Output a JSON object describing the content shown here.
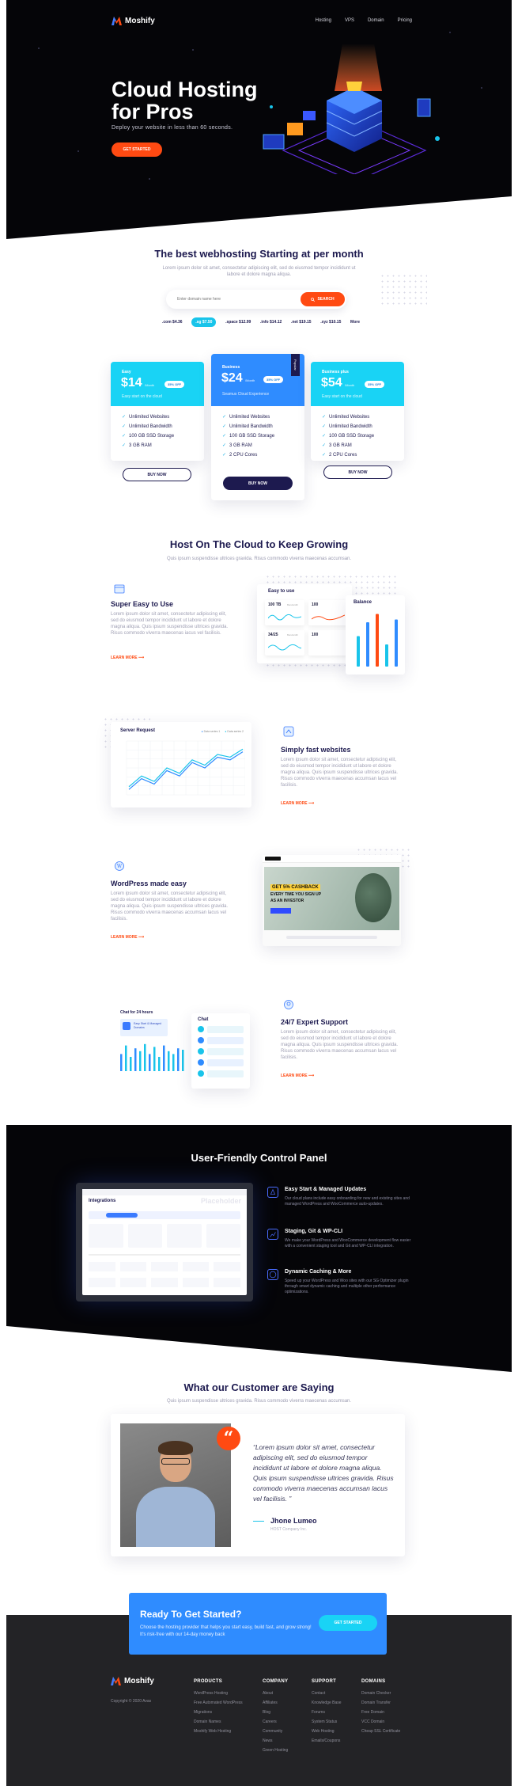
{
  "nav": {
    "brand": "Moshify",
    "links": [
      "Hosting",
      "VPS",
      "Domain",
      "Pricing"
    ]
  },
  "hero": {
    "title": "Cloud Hosting for Pros",
    "subtitle": "Deploy your website in less than 60 seconds.",
    "cta": "GET STARTED"
  },
  "pricing_intro": {
    "title": "The best webhosting Starting at per month",
    "subtitle": "Lorem ipsum dolor sit amet, consectetur adipiscing elit, sed do eiusmod tempor incididunt ut labore et dolore magna aliqua.",
    "search_placeholder": "Enter domain name here",
    "search_button": "SEARCH",
    "domains": [
      ".com $4.36",
      ".sg $7.50",
      ".space $12.99",
      ".info $14.12",
      ".net $19.15",
      ".xyz $10.15",
      "More"
    ]
  },
  "plans": [
    {
      "name": "Easy",
      "price": "$14",
      "per": "/Month",
      "off": "35% OFF",
      "tag": "Easy start on the cloud",
      "features": [
        "Unlimited Websites",
        "Unlimited Bandwidth",
        "100 GB SSD Storage",
        "3 GB RAM"
      ],
      "button": "BUY NOW"
    },
    {
      "name": "Business",
      "price": "$24",
      "per": "/Month",
      "off": "35% OFF",
      "tag": "Seamus Cloud Experience",
      "ribbon": "Popular",
      "features": [
        "Unlimited Websites",
        "Unlimited Bandwidth",
        "100 GB SSD Storage",
        "3 GB RAM",
        "2 CPU Cores"
      ],
      "button": "BUY NOW"
    },
    {
      "name": "Business plus",
      "price": "$54",
      "per": "/Month",
      "off": "35% OFF",
      "tag": "Easy start on the cloud",
      "features": [
        "Unlimited Websites",
        "Unlimited Bandwidth",
        "100 GB SSD Storage",
        "3 GB RAM",
        "2 CPU Cores"
      ],
      "button": "BUY NOW"
    }
  ],
  "grow": {
    "title": "Host On The Cloud to Keep Growing",
    "subtitle": "Quis ipsum suspendisse ultrices gravida. Risus commodo viverra maecenas accumsan."
  },
  "features": [
    {
      "title": "Super Easy to Use",
      "text": "Lorem ipsum dolor sit amet, consectetur adipiscing elit, sed do eiusmod tempor incididunt ut labore et dolore magna aliqua. Quis ipsum suspendisse ultrices gravida. Risus commodo viverra maecenas iacus vel facilisis.",
      "link": "LEARN MORE"
    },
    {
      "title": "Simply fast websites",
      "text": "Lorem ipsum dolor sit amet, consectetur adipiscing elit, sed do eiusmod tempor incididunt ut labore et dolore magna aliqua. Quis ipsum suspendisse ultrices gravida. Risus commodo viverra maecenas accumsan lacus vel facilisis.",
      "link": "LEARN MORE"
    },
    {
      "title": "WordPress made easy",
      "text": "Lorem ipsum dolor sit amet, consectetur adipiscing elit, sed do eiusmod tempor incididunt ut labore et dolore magna aliqua. Quis ipsum suspendisse ultrices gravida. Risus commodo viverra maecenas accumsan lacus vel facilisis.",
      "link": "LEARN MORE"
    },
    {
      "title": "24/7 Expert Support",
      "text": "Lorem ipsum dolor sit amet, consectetur adipiscing elit, sed do eiusmod tempor incididunt ut labore et dolore magna aliqua. Quis ipsum suspendisse ultrices gravida. Risus commodo viverra maecenas accumsan lacus vel facilisis.",
      "link": "LEARN MORE"
    }
  ],
  "widgets": {
    "easy_title": "Easy to use",
    "easy_stats": [
      "100 TB",
      "34/25",
      "100",
      "100"
    ],
    "easy_stat_labels": [
      "Bandwidth",
      "Bandwidth"
    ],
    "balance_title": "Balance",
    "balance_bars": [
      0.55,
      0.8,
      0.95,
      0.4,
      0.85
    ],
    "server_title": "Server Request",
    "server_legend": [
      "Data series 1",
      "Data series 2"
    ],
    "server_series1": [
      2,
      6,
      4,
      9,
      7,
      12,
      10,
      14,
      13,
      16
    ],
    "server_series2": [
      3,
      7,
      5,
      10,
      8,
      13,
      11,
      15,
      14,
      17
    ],
    "chat_title": "Chat for 24 hours",
    "chat_agent": "Easy Start & Managed Domains",
    "chat_bars": [
      0.6,
      0.9,
      0.5,
      0.8,
      0.7,
      0.95,
      0.6,
      0.85,
      0.5,
      0.9,
      0.7,
      0.6,
      0.8,
      0.75
    ],
    "chat_panel_title": "Chat",
    "cashback": {
      "headline": "GET 5% CASHBACK",
      "line2": "EVERY TIME YOU SIGN UP",
      "line3": "AS AN INVESTOR"
    }
  },
  "control": {
    "title": "User-Friendly Control Panel",
    "screen_title": "Integrations",
    "screen_placeholder": "Placeholder",
    "items": [
      {
        "title": "Easy Start & Managed Updates",
        "text": "Our cloud plans include easy onboarding for new and existing sites and managed WordPress and WooCommerce auto-updates."
      },
      {
        "title": "Staging, Git & WP-CLI",
        "text": "We make your WordPress and WooCommerce development flow easier with a convenient staging tool and Git and WP-CLI integration."
      },
      {
        "title": "Dynamic Caching & More",
        "text": "Speed up your WordPress and Woo sites with our SG Optimizer plugin through smart dynamic caching and multiple other performance optimizations."
      }
    ]
  },
  "testimonial": {
    "title": "What our Customer are Saying",
    "subtitle": "Quis ipsum suspendisse ultrices gravida. Risus commodo viverra maecenas accumsan.",
    "quote": "“Lorem ipsum dolor sit amet, consectetur adipiscing elit, sed do eiusmod tempor incididunt ut labore et dolore magna aliqua. Quis ipsum suspendisse ultrices gravida. Risus commodo viverra maecenas accumsan lacus vel facilisis. ”",
    "author": "Jhone Lumeo",
    "role": "HOST Company Inc."
  },
  "cta": {
    "title": "Ready To Get Started?",
    "text": "Choose the hosting provider that helps you start easy, build fast, and grow strong! It's risk-free with our 14-day money back",
    "button": "GET STARTED"
  },
  "footer": {
    "brand": "Moshify",
    "copyright": "Copyright © 2020 Avas",
    "columns": [
      {
        "title": "PRODUCTS",
        "links": [
          "WordPress Hosting",
          "Free Automated WordPress",
          "Migrations",
          "Domain Names",
          "Moshify Web Hosting"
        ]
      },
      {
        "title": "COMPANY",
        "links": [
          "About",
          "Affiliates",
          "Blog",
          "Careers",
          "Community",
          "News",
          "Green Hosting"
        ]
      },
      {
        "title": "SUPPORT",
        "links": [
          "Contact",
          "Knowledge Base",
          "Forums",
          "System Status",
          "Web Hosting",
          "Emails/Coupons"
        ]
      },
      {
        "title": "DOMAINS",
        "links": [
          "Domain Checker",
          "Domain Transfer",
          "Free Domain",
          "VCC Domain",
          "Cheap SSL Certificate"
        ]
      }
    ]
  },
  "colors": {
    "accent": "#ff4a12",
    "navy": "#1d1a4f",
    "cyan": "#19c4ea",
    "blue": "#2f8cff"
  }
}
